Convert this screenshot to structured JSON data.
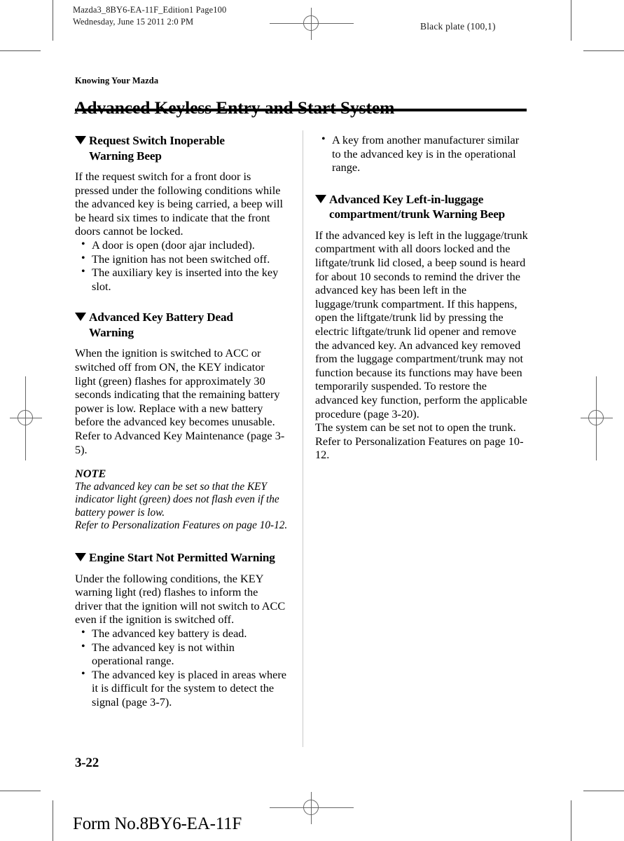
{
  "running_head": {
    "left": "Mazda3_8BY6-EA-11F_Edition1 Page100\nWednesday, June 15 2011 2:0 PM",
    "right": "Black plate (100,1)"
  },
  "title_block": {
    "eyebrow": "Knowing Your Mazda",
    "title": "Advanced Keyless Entry and Start System"
  },
  "left_column": {
    "section1": {
      "heading_line1": "Request Switch Inoperable",
      "heading_line2": "Warning Beep",
      "paragraph": "If the request switch for a front door is pressed under the following conditions while the advanced key is being carried, a beep will be heard six times to indicate that the front doors cannot be locked.",
      "bullets": [
        "A door is open (door ajar included).",
        "The ignition has not been switched off.",
        "The auxiliary key is inserted into the key slot."
      ]
    },
    "section2": {
      "heading_line1": "Advanced Key Battery Dead",
      "heading_line2": "Warning",
      "paragraph": "When the ignition is switched to ACC or switched off from ON, the KEY indicator light (green) flashes for approximately 30 seconds indicating that the remaining battery power is low. Replace with a new battery before the advanced key becomes unusable.",
      "reference": "Refer to Advanced Key Maintenance (page 3-5).",
      "note_label": "NOTE",
      "note_paragraph": "The advanced key can be set so that the KEY indicator light (green) does not flash even if the battery power is low.",
      "note_reference": "Refer to Personalization Features on page 10-12."
    },
    "section3": {
      "heading_line1": "Engine Start Not Permitted Warning",
      "paragraph": "Under the following conditions, the KEY warning light (red) flashes to inform the driver that the ignition will not switch to ACC even if the ignition is switched off.",
      "bullets": [
        "The advanced key battery is dead.",
        "The advanced key is not within operational range.",
        "The advanced key is placed in areas where it is difficult for the system to detect the signal (page 3-7)."
      ]
    }
  },
  "right_column": {
    "continued_bullets": [
      "A key from another manufacturer similar to the advanced key is in the operational range."
    ],
    "section1": {
      "heading_line1": "Advanced Key Left-in-luggage",
      "heading_line2": "compartment/trunk Warning Beep",
      "paragraph": "If the advanced key is left in the luggage/trunk compartment with all doors locked and the liftgate/trunk lid closed, a beep sound is heard for about 10 seconds to remind the driver the advanced key has been left in the luggage/trunk compartment. If this happens, open the liftgate/trunk lid by pressing the electric liftgate/trunk lid opener and remove the advanced key. An advanced key removed from the luggage compartment/trunk may not function because its functions may have been temporarily suspended. To restore the advanced key function, perform the applicable procedure (page 3-20).",
      "paragraph2": "The system can be set not to open the trunk.",
      "reference": "Refer to Personalization Features on page 10-12."
    }
  },
  "footer": {
    "folio": "3-22",
    "form_number": "Form No.8BY6-EA-11F"
  },
  "colors": {
    "text": "#000000",
    "rule": "#000000",
    "divider": "#c9c9c9",
    "mark": "#666666"
  }
}
